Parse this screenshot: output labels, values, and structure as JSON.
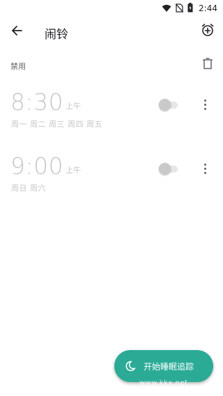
{
  "status_bar": {
    "time": "2:44",
    "icons": [
      "wifi-icon",
      "no-sim-icon",
      "battery-charging-icon"
    ]
  },
  "app_bar": {
    "title": "闹铃",
    "back_icon": "arrow-back-icon",
    "add_icon": "alarm-add-icon"
  },
  "section": {
    "label": "禁用",
    "delete_icon": "trash-icon"
  },
  "alarms": [
    {
      "time": "8:30",
      "ampm": "上午",
      "days": "周一 周二 周三 周四 周五",
      "enabled": false
    },
    {
      "time": "9:00",
      "ampm": "上午",
      "days": "周日 周六",
      "enabled": false
    }
  ],
  "fab": {
    "label": "开始睡眠追踪",
    "icon": "moon-icon"
  },
  "watermark": "www.kkx.net",
  "colors": {
    "accent": "#2bab96",
    "disabled_text": "#c6c6c6",
    "icon": "#5f6368"
  }
}
